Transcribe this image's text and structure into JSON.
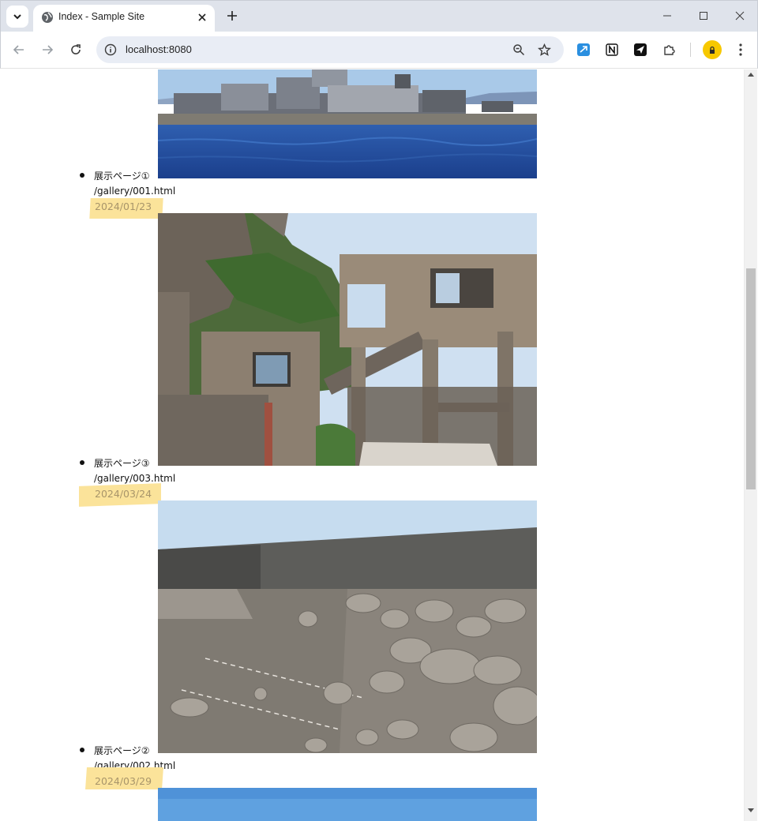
{
  "browser": {
    "tab_title": "Index - Sample Site",
    "url": "localhost:8080"
  },
  "gallery": {
    "entries": [
      {
        "title": "展示ページ①",
        "path": "/gallery/001.html",
        "date": "2024/01/23"
      },
      {
        "title": "展示ページ③",
        "path": "/gallery/003.html",
        "date": "2024/03/24"
      },
      {
        "title": "展示ページ②",
        "path": "/gallery/002.html",
        "date": "2024/03/29"
      }
    ]
  },
  "colors": {
    "highlight": "#fbe39a",
    "date_text": "#a8956a",
    "profile": "#f7c800"
  }
}
